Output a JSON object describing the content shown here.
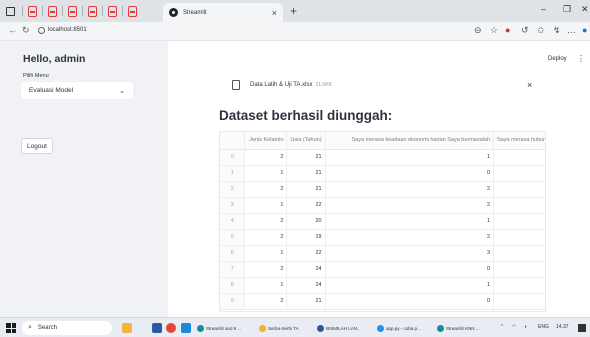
{
  "browser": {
    "active_tab_title": "Streamlit",
    "active_tab_close": "×",
    "new_tab": "+",
    "url": "localhost:8501",
    "win_minimize": "–",
    "win_maximize": "❐",
    "win_close": "✕"
  },
  "sidebar": {
    "greeting": "Hello, admin",
    "menu_label": "Pilih Menu",
    "menu_selected": "Evaluasi Model",
    "logout_label": "Logout"
  },
  "toolbar": {
    "deploy_label": "Deploy"
  },
  "upload": {
    "file_name": "Data Latih & Uji TA.xlsx",
    "file_size": "21.5KB",
    "close": "×"
  },
  "main": {
    "heading": "Dataset berhasil diunggah:"
  },
  "table": {
    "columns": [
      "",
      "Jenis Kelamin",
      "Usia (Tahun)",
      "Saya merasa keadaan ekonomi harian Saya bermasalah",
      "Saya merasa hubun"
    ],
    "rows": [
      [
        "0",
        "2",
        "21",
        "1",
        ""
      ],
      [
        "1",
        "1",
        "21",
        "0",
        ""
      ],
      [
        "2",
        "2",
        "21",
        "2",
        ""
      ],
      [
        "3",
        "1",
        "22",
        "2",
        ""
      ],
      [
        "4",
        "2",
        "20",
        "1",
        ""
      ],
      [
        "5",
        "2",
        "19",
        "2",
        ""
      ],
      [
        "6",
        "1",
        "22",
        "3",
        ""
      ],
      [
        "7",
        "2",
        "24",
        "0",
        ""
      ],
      [
        "8",
        "1",
        "24",
        "1",
        ""
      ],
      [
        "9",
        "2",
        "21",
        "0",
        ""
      ]
    ]
  },
  "taskbar": {
    "search_placeholder": "Search",
    "apps": [
      "Streamlit and 6 ...",
      "Serba-Serbi TA",
      "BISMILAH LAN...",
      "app.py - coba p...",
      "Streamlit KNN ..."
    ],
    "tray_lang": "ENG",
    "tray_time": "14.37"
  },
  "colors": {
    "sidebar_bg": "#f0f2f6",
    "accent_red": "#e0393e",
    "text": "#31333f"
  }
}
